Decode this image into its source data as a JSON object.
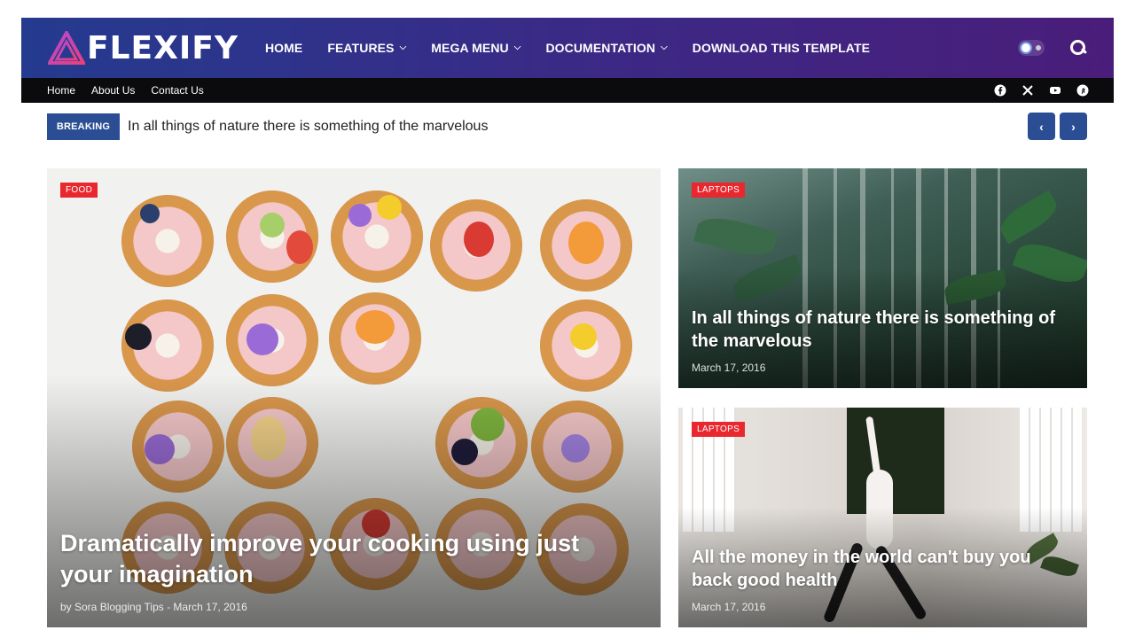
{
  "header": {
    "logo_text": "FLEXIFY",
    "nav": [
      {
        "label": "HOME",
        "has_dropdown": false
      },
      {
        "label": "FEATURES",
        "has_dropdown": true
      },
      {
        "label": "MEGA MENU",
        "has_dropdown": true
      },
      {
        "label": "DOCUMENTATION",
        "has_dropdown": true
      },
      {
        "label": "DOWNLOAD THIS TEMPLATE",
        "has_dropdown": false
      }
    ],
    "icons": [
      "theme-toggle-icon",
      "search-icon"
    ]
  },
  "topbar": {
    "links": [
      "Home",
      "About Us",
      "Contact Us"
    ],
    "social_icons": [
      "facebook-icon",
      "x-icon",
      "youtube-icon",
      "pinterest-icon"
    ]
  },
  "breaking": {
    "label": "BREAKING",
    "text": "In all things of nature there is something of the marvelous",
    "prev": "‹",
    "next": "›"
  },
  "featured": {
    "main": {
      "tag": "FOOD",
      "title": "Dramatically improve your cooking using just your imagination",
      "meta": "by Sora Blogging Tips - March 17, 2016"
    },
    "side_top": {
      "tag": "LAPTOPS",
      "title": "In all things of nature there is something of the marvelous",
      "meta": "March 17, 2016"
    },
    "side_bottom": {
      "tag": "LAPTOPS",
      "title": "All the money in the world can't buy you back good health",
      "meta": "March 17, 2016"
    }
  },
  "colors": {
    "header_gradient_start": "#243b8f",
    "header_gradient_end": "#4a1d7a",
    "topbar": "#0b0b0d",
    "accent_blue": "#2b4d93",
    "tag_red": "#e8282e"
  }
}
